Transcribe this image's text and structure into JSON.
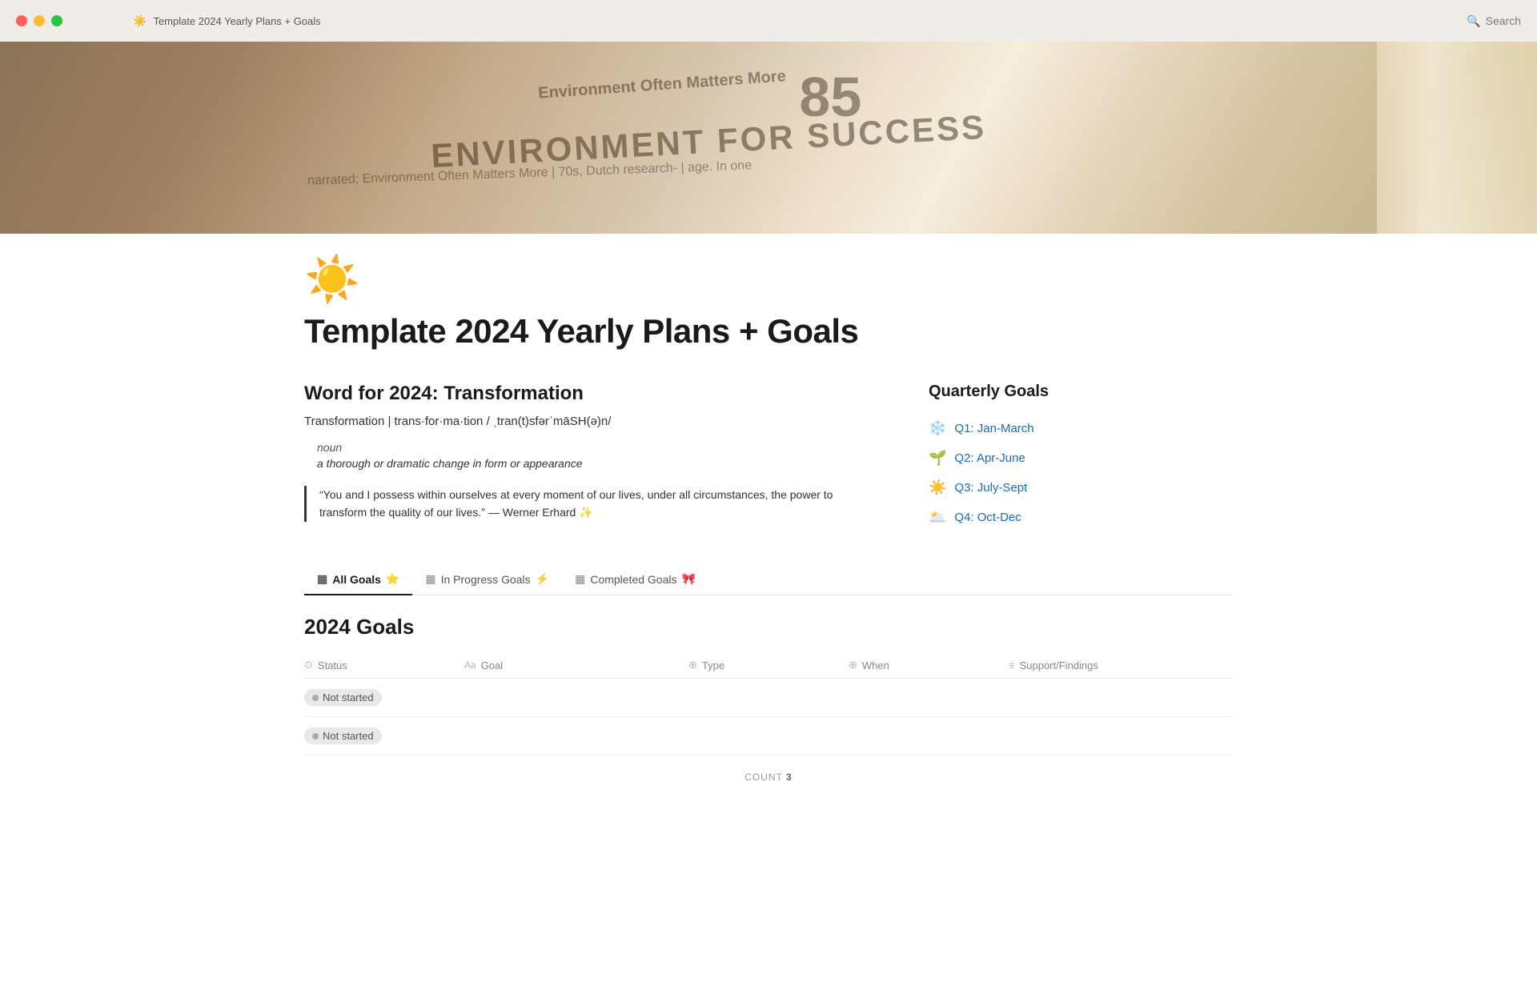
{
  "window": {
    "title": "Template 2024 Yearly Plans + Goals",
    "traffic_lights": [
      "red",
      "yellow",
      "green"
    ]
  },
  "topbar": {
    "breadcrumb_icon": "☀️",
    "breadcrumb_text": "Template 2024 Yearly Plans + Goals",
    "search_label": "Search"
  },
  "cover": {
    "text1": "ENVIRONMENT FOR SUCCESS",
    "text2": "Environment Often Matters More",
    "number": "85",
    "line1": "narrated; Environment Often Matters More"
  },
  "page": {
    "icon": "☀️",
    "title": "Template 2024 Yearly Plans + Goals"
  },
  "word_section": {
    "heading": "Word for 2024: Transformation",
    "pronunciation": "Transformation | trans·for·ma·tion / ˌtran(t)sfərˈmāSH(ə)n/",
    "pos": "noun",
    "definition": "a thorough or dramatic change in form or appearance",
    "quote": "“You and I possess within ourselves at every moment of our lives, under all circumstances, the power to transform the quality of our lives.” — Werner Erhard ✨"
  },
  "quarterly_goals": {
    "heading": "Quarterly Goals",
    "items": [
      {
        "emoji": "❄️",
        "label": "Q1: Jan-March"
      },
      {
        "emoji": "🌱",
        "label": "Q2: Apr-June"
      },
      {
        "emoji": "☀️",
        "label": "Q3: July-Sept"
      },
      {
        "emoji": "🌥️",
        "label": "Q4: Oct-Dec"
      }
    ]
  },
  "tabs": [
    {
      "icon": "▦",
      "label": "All Goals",
      "emoji": "⭐",
      "active": true
    },
    {
      "icon": "▦",
      "label": "In Progress Goals",
      "emoji": "⚡",
      "active": false
    },
    {
      "icon": "▦",
      "label": "Completed Goals",
      "emoji": "🎀",
      "active": false
    }
  ],
  "goals_section": {
    "heading": "2024 Goals",
    "columns": [
      {
        "icon": "⊙",
        "label": "Status"
      },
      {
        "icon": "Aa",
        "label": "Goal"
      },
      {
        "icon": "⊕",
        "label": "Type"
      },
      {
        "icon": "⊕",
        "label": "When"
      },
      {
        "icon": "≡",
        "label": "Support/Findings"
      }
    ],
    "rows": [
      {
        "status": "Not started"
      },
      {
        "status": "Not started"
      }
    ],
    "count_label": "COUNT",
    "count_value": "3"
  }
}
